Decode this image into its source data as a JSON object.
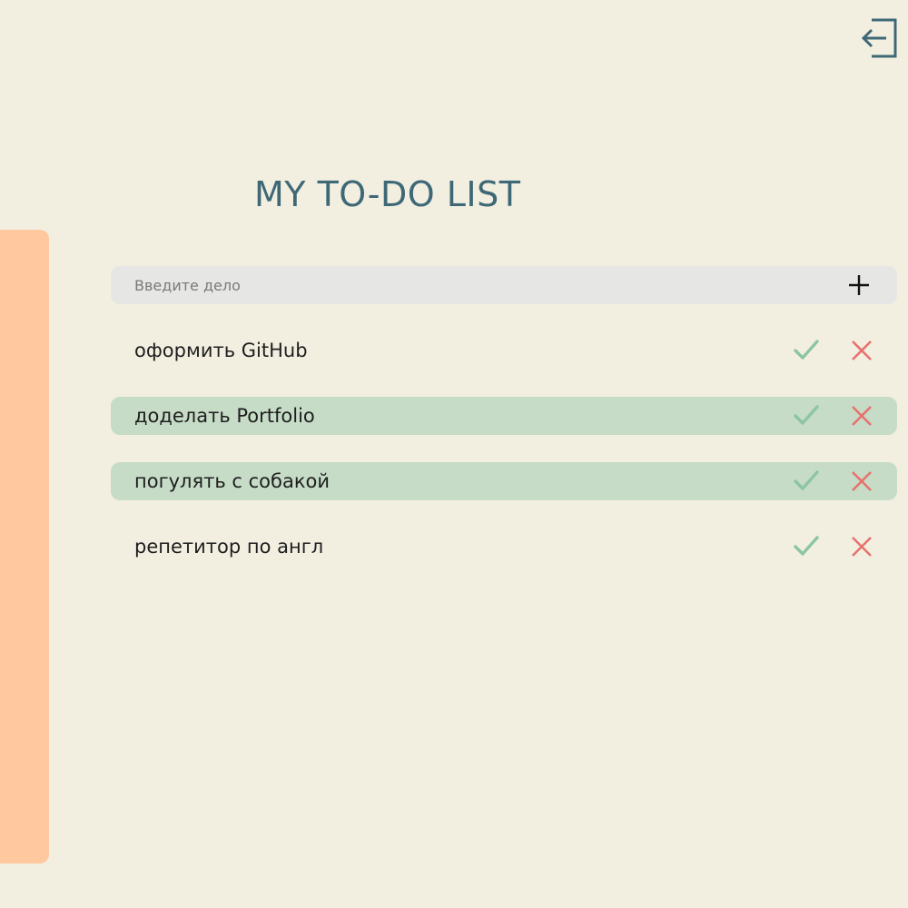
{
  "header": {
    "title": "MY TO-DO LIST",
    "logout_icon": "logout-arrow-icon"
  },
  "add_task": {
    "placeholder": "Введите дело",
    "value": "",
    "add_icon": "plus-icon"
  },
  "tasks": [
    {
      "text": "оформить GitHub",
      "completed": false
    },
    {
      "text": "доделать Portfolio",
      "completed": true
    },
    {
      "text": "погулять с собакой",
      "completed": true
    },
    {
      "text": "репетитор по англ",
      "completed": false
    }
  ],
  "task_actions": {
    "complete_icon": "checkmark-icon",
    "delete_icon": "cross-icon"
  },
  "colors": {
    "background": "#f2efe1",
    "side_panel": "#ffc89e",
    "title": "#3f6877",
    "input_background": "#e6e6e4",
    "completed_task": "#c6dcc7",
    "checkmark": "#8cc5a2",
    "delete": "#e8716d",
    "logout_icon": "#3f6877"
  }
}
